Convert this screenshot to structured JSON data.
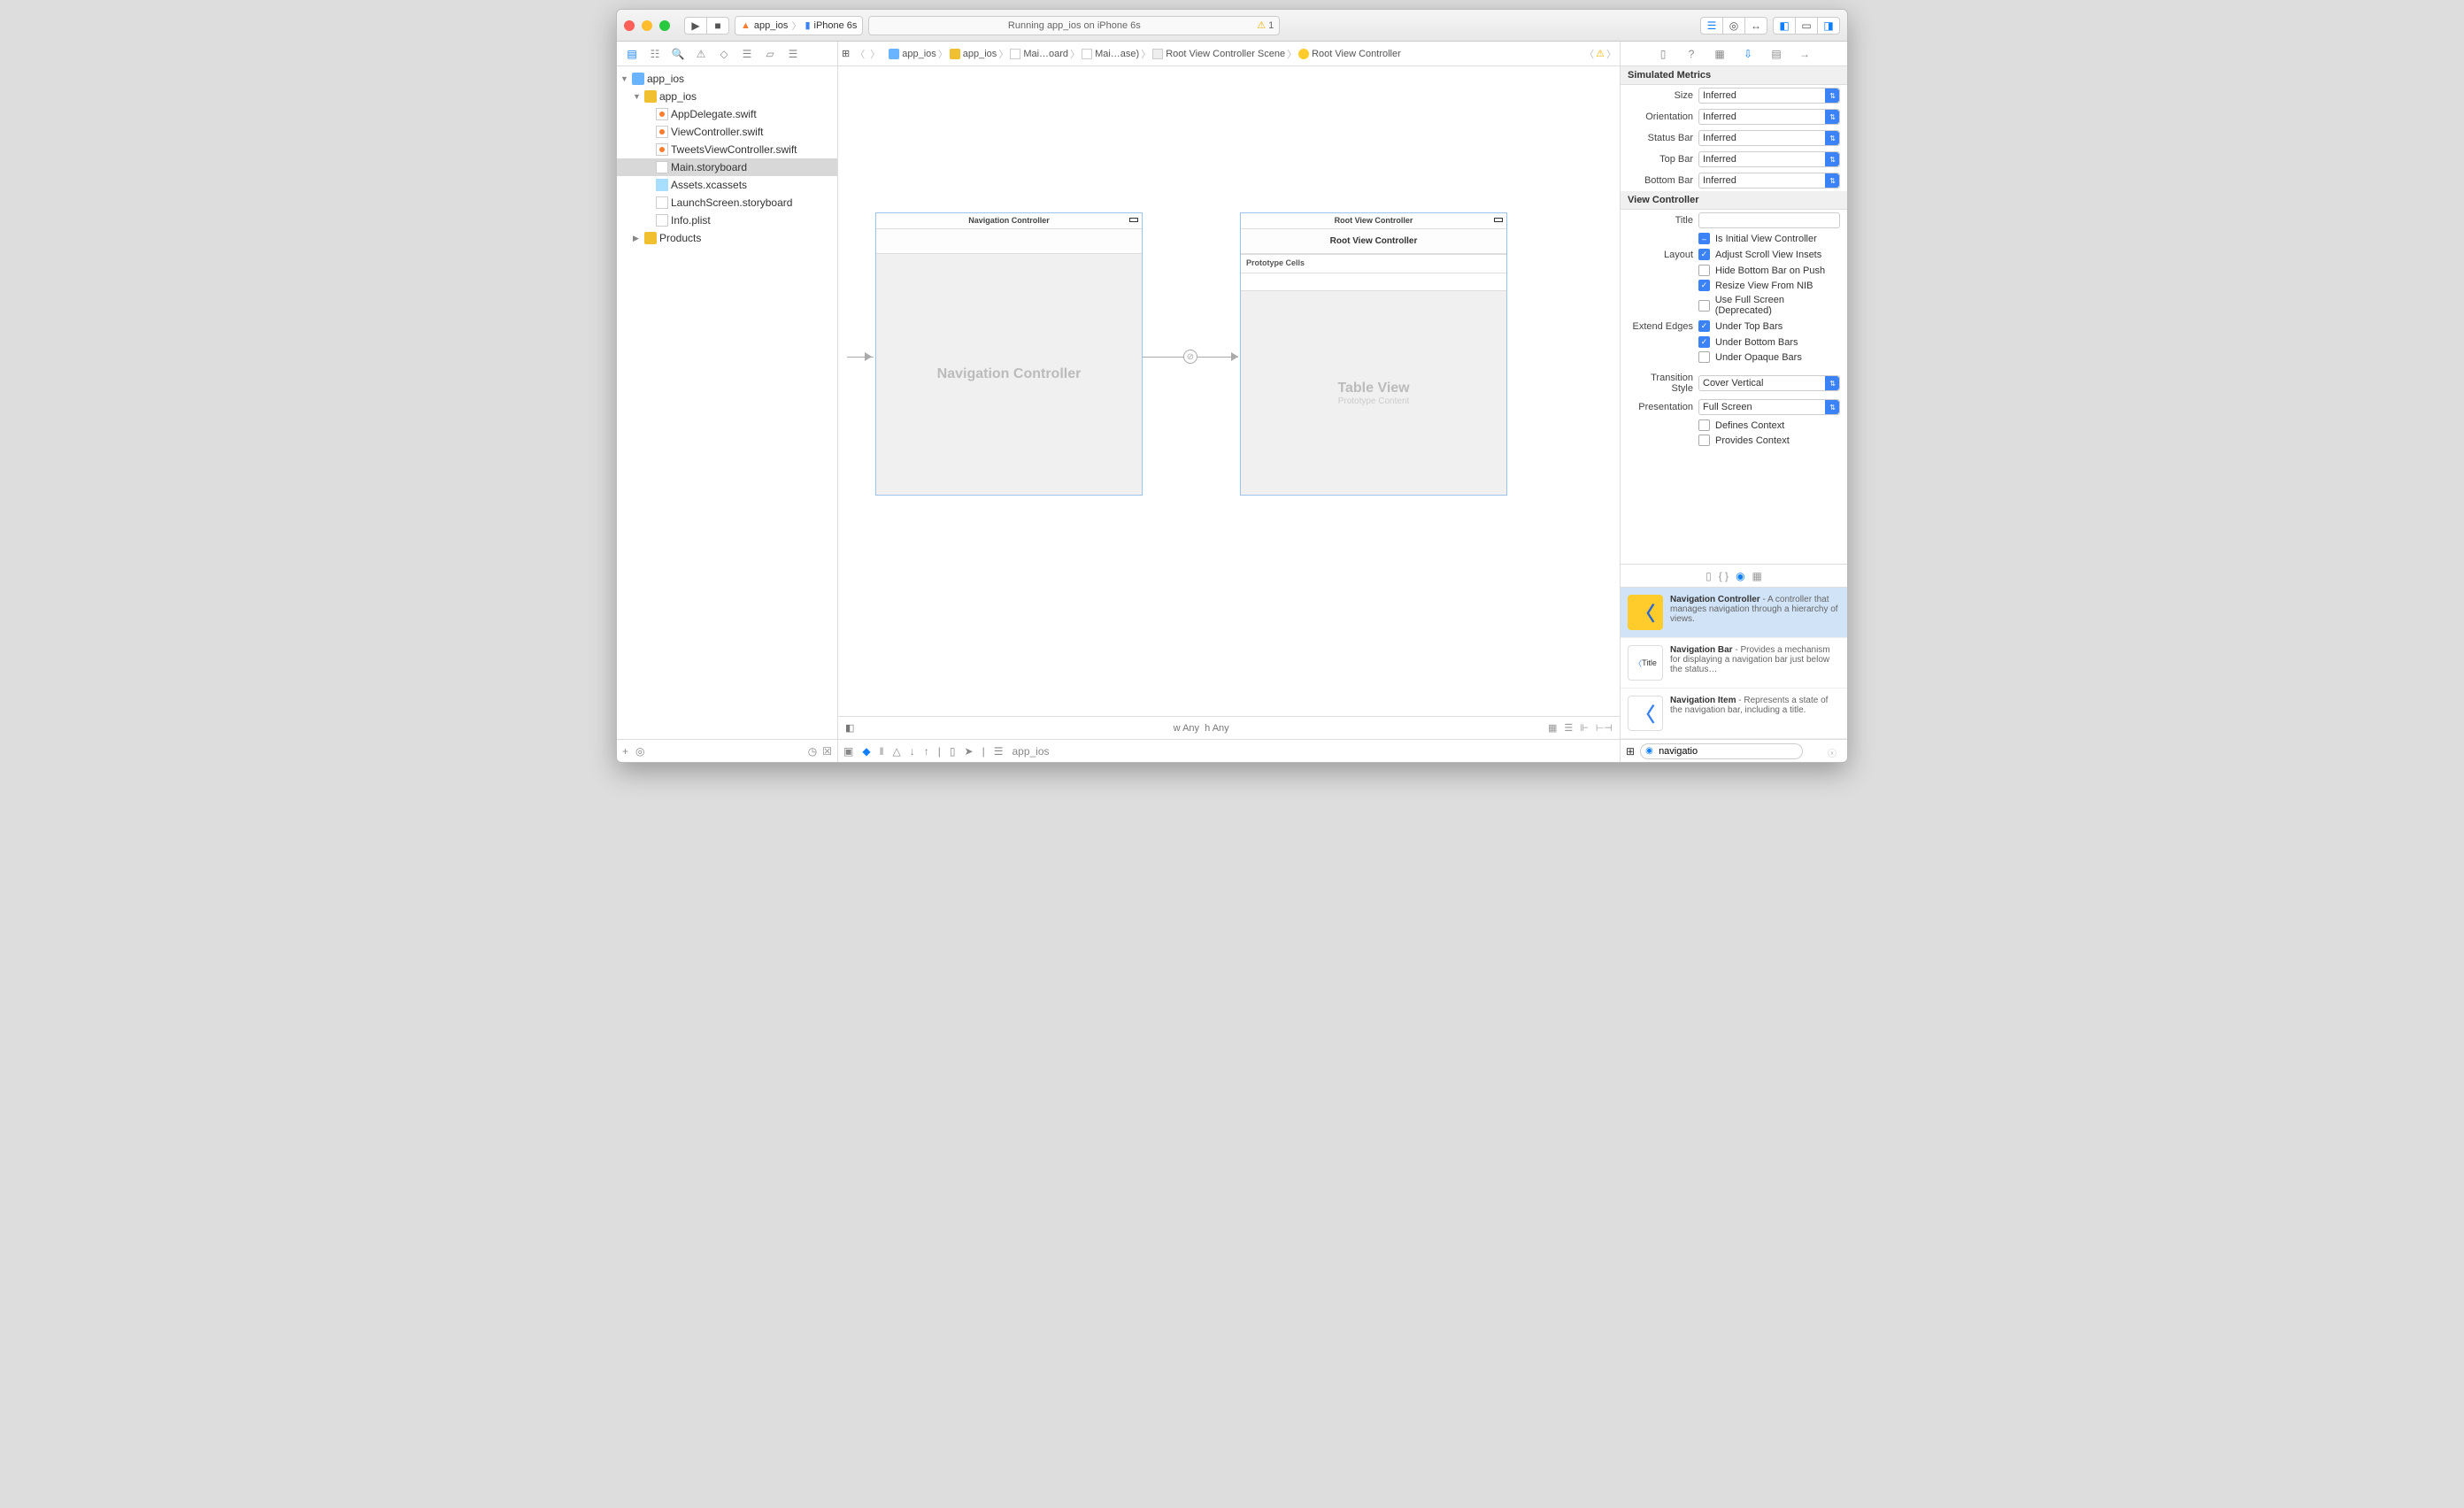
{
  "toolbar": {
    "scheme_target": "app_ios",
    "scheme_device": "iPhone 6s",
    "status_text": "Running app_ios on iPhone 6s",
    "status_warn_count": "1"
  },
  "navigator": {
    "root": "app_ios",
    "group": "app_ios",
    "files": [
      "AppDelegate.swift",
      "ViewController.swift",
      "TweetsViewController.swift",
      "Main.storyboard",
      "Assets.xcassets",
      "LaunchScreen.storyboard",
      "Info.plist"
    ],
    "products": "Products"
  },
  "jumpbar": {
    "items": [
      "app_ios",
      "app_ios",
      "Mai…oard",
      "Mai…ase)",
      "Root View Controller Scene",
      "Root View Controller"
    ]
  },
  "canvas": {
    "scene1_title": "Navigation Controller",
    "scene1_body": "Navigation Controller",
    "scene2_title": "Root View Controller",
    "scene2_nav": "Root View Controller",
    "scene2_proto": "Prototype Cells",
    "scene2_body": "Table View",
    "scene2_sub": "Prototype Content",
    "size_w": "w Any",
    "size_h": "h Any",
    "debug_target": "app_ios"
  },
  "inspector": {
    "sim_header": "Simulated Metrics",
    "size_label": "Size",
    "size_val": "Inferred",
    "orient_label": "Orientation",
    "orient_val": "Inferred",
    "status_label": "Status Bar",
    "status_val": "Inferred",
    "top_label": "Top Bar",
    "top_val": "Inferred",
    "bottom_label": "Bottom Bar",
    "bottom_val": "Inferred",
    "vc_header": "View Controller",
    "title_label": "Title",
    "initial_label": "Is Initial View Controller",
    "layout_label": "Layout",
    "adjust_label": "Adjust Scroll View Insets",
    "hide_label": "Hide Bottom Bar on Push",
    "resize_label": "Resize View From NIB",
    "fullscreen_label": "Use Full Screen (Deprecated)",
    "extend_label": "Extend Edges",
    "under_top": "Under Top Bars",
    "under_bottom": "Under Bottom Bars",
    "under_opaque": "Under Opaque Bars",
    "trans_label": "Transition Style",
    "trans_val": "Cover Vertical",
    "pres_label": "Presentation",
    "pres_val": "Full Screen",
    "defines_label": "Defines Context",
    "provides_label": "Provides Context"
  },
  "library": {
    "item1_title": "Navigation Controller",
    "item1_desc": " - A controller that manages navigation through a hierarchy of views.",
    "item2_title": "Navigation Bar",
    "item2_desc": " - Provides a mechanism for displaying a navigation bar just below the status…",
    "item2_badge": "Title",
    "item3_title": "Navigation Item",
    "item3_desc": " - Represents a state of the navigation bar, including a title.",
    "search_value": "navigatio"
  }
}
